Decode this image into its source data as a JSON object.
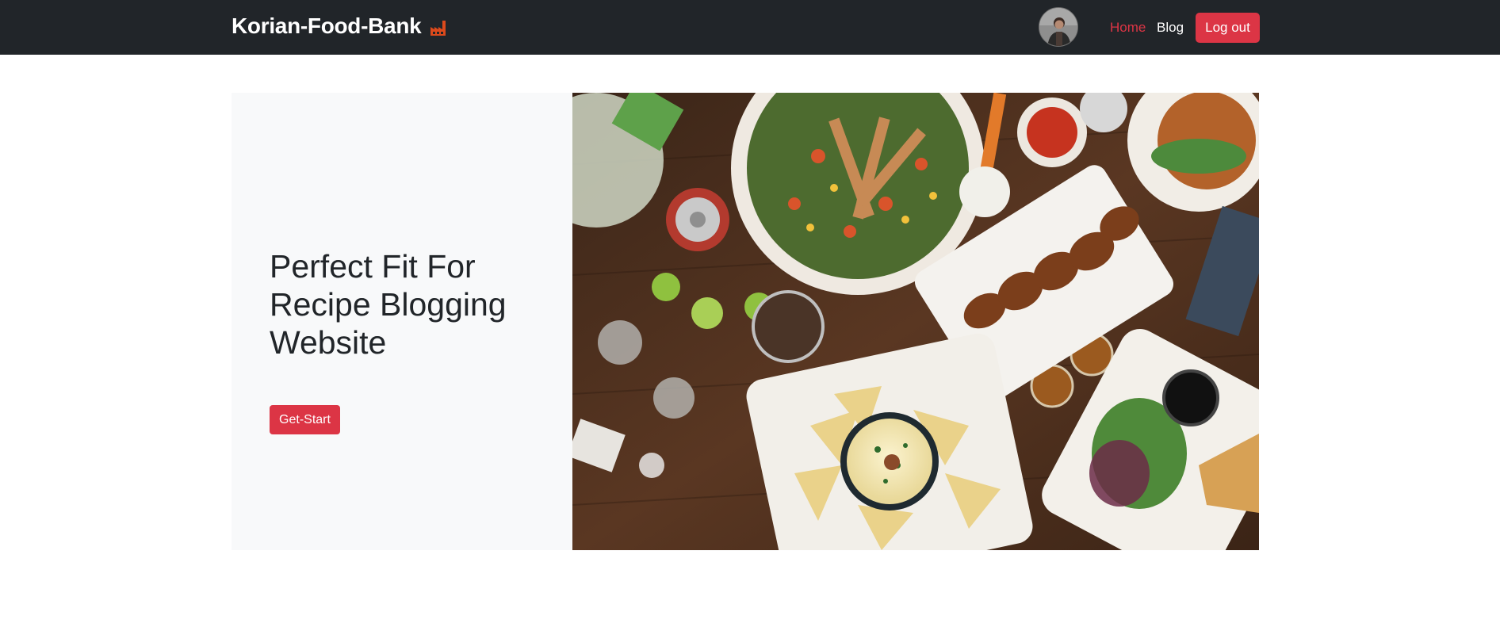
{
  "navbar": {
    "brand": "Korian-Food-Bank",
    "brand_icon": "factory-icon",
    "avatar_icon": "user-avatar",
    "links": [
      {
        "label": "Home",
        "active": true
      },
      {
        "label": "Blog",
        "active": false
      }
    ],
    "logout_label": "Log out"
  },
  "hero": {
    "title": "Perfect Fit For Recipe Blogging Website",
    "cta_label": "Get-Start",
    "image": "food-spread-photo"
  },
  "colors": {
    "navbar_bg": "#212529",
    "accent": "#dc3545",
    "hero_left_bg": "#f8f9fa",
    "text": "#212529"
  }
}
